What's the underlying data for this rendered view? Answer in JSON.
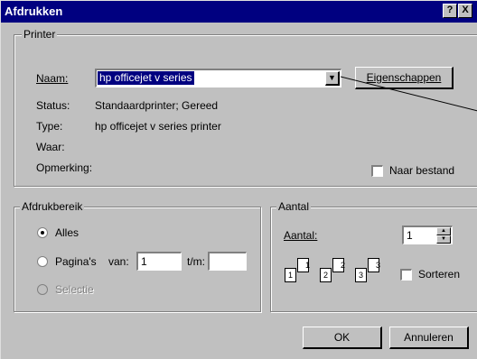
{
  "window": {
    "title": "Afdrukken",
    "help_label": "?",
    "close_label": "X"
  },
  "printer": {
    "group_label": "Printer",
    "name_label": "Naam:",
    "name_value": "hp officejet v series",
    "properties_button": "Eigenschappen",
    "status_label": "Status:",
    "status_value": "Standaardprinter; Gereed",
    "type_label": "Type:",
    "type_value": "hp officejet v series printer",
    "where_label": "Waar:",
    "comment_label": "Opmerking:",
    "print_to_file_label": "Naar bestand"
  },
  "range": {
    "group_label": "Afdrukbereik",
    "all_label": "Alles",
    "pages_label": "Pagina's",
    "from_label": "van:",
    "from_value": "1",
    "to_label": "t/m:",
    "to_value": "",
    "selection_label": "Selectie"
  },
  "copies": {
    "group_label": "Aantal",
    "count_label": "Aantal:",
    "count_value": "1",
    "collate_label": "Sorteren",
    "collate_pages": [
      "1",
      "1",
      "2",
      "2",
      "3",
      "3"
    ]
  },
  "actions": {
    "ok_label": "OK",
    "cancel_label": "Annuleren"
  }
}
